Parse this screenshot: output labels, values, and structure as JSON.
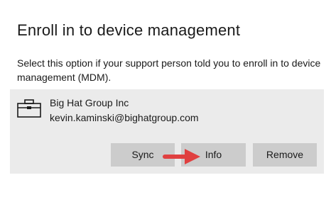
{
  "section": {
    "title": "Enroll in to device management",
    "description": "Select this option if your support person told you to enroll in to device management (MDM)."
  },
  "account": {
    "icon": "briefcase-icon",
    "org_name": "Big Hat Group Inc",
    "email": "kevin.kaminski@bighatgroup.com"
  },
  "buttons": {
    "sync_label": "Sync",
    "info_label": "Info",
    "remove_label": "Remove"
  },
  "annotation": {
    "icon": "red-arrow-icon",
    "color": "#e04040"
  },
  "colors": {
    "card_background": "#ebebeb",
    "button_background": "#cccccc"
  }
}
